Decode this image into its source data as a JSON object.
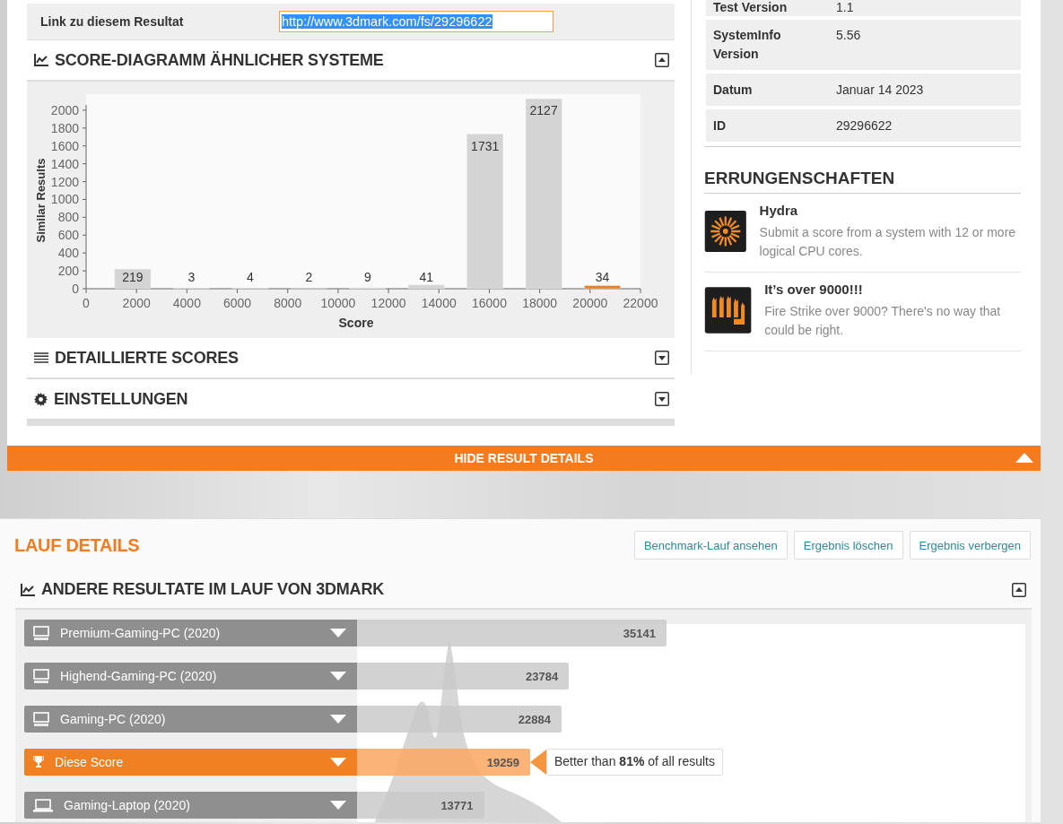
{
  "result_link": {
    "label": "Link zu diesem Resultat",
    "value": "http://www.3dmark.com/fs/29296622"
  },
  "sections": [
    {
      "kind": "chart",
      "title": "SCORE-DIAGRAMM ÄHNLICHER SYSTEME",
      "expanded": true,
      "highlight": {
        "color": "#f47b20",
        "bars": [
          false,
          false,
          false,
          false,
          false,
          false,
          false,
          false,
          true
        ]
      },
      "chart_data": {
        "type": "bar",
        "xlabel": "Score",
        "ylabel": "Similar Results",
        "x": [
          1850,
          4180,
          6510,
          8840,
          11170,
          13500,
          15830,
          18160,
          20490
        ],
        "series": [
          {
            "color": "#d4d4d4",
            "values": [
              219,
              3,
              4,
              2,
              9,
              41,
              1731,
              2127,
              34
            ]
          }
        ],
        "xlim": [
          0,
          22000
        ],
        "ylim": [
          0,
          2180
        ],
        "xticks": [
          0,
          2000,
          4000,
          6000,
          8000,
          10000,
          12000,
          14000,
          16000,
          18000,
          20000,
          22000
        ],
        "yticks": [
          0,
          200,
          400,
          600,
          800,
          1000,
          1200,
          1400,
          1600,
          1800,
          2000
        ],
        "data_labels": true
      }
    },
    {
      "kind": "list",
      "title": "DETAILLIERTE SCORES",
      "expanded": false
    },
    {
      "kind": "settings",
      "title": "EINSTELLUNGEN",
      "expanded": false
    }
  ],
  "info_rows": [
    {
      "label": "Test Version",
      "value": "1.1"
    },
    {
      "label": "SystemInfo Version",
      "value": "5.56"
    },
    {
      "label": "Datum",
      "value": "Januar 14 2023"
    },
    {
      "label": "ID",
      "value": "29296622"
    }
  ],
  "achievements": {
    "title": "ERRUNGENSCHAFTEN",
    "items": [
      {
        "kind": "cores",
        "title": "Hydra",
        "description": "Submit a score from a system with 12 or more logical CPU cores."
      },
      {
        "kind": "fire",
        "title": "It’s over 9000!!!",
        "description": "Fire Strike over 9000? There's no way that could be right."
      }
    ]
  },
  "hide_bar": {
    "label": "HIDE RESULT DETAILS"
  },
  "run_details": {
    "title": "LAUF DETAILS",
    "buttons": [
      "Benchmark-Lauf ansehen",
      "Ergebnis löschen",
      "Ergebnis verbergen"
    ],
    "section": {
      "title": "ANDERE RESULTATE IM LAUF VON 3DMARK",
      "expanded": true
    },
    "rows": [
      {
        "kind": "desktop",
        "name": "Premium-Gaming-PC (2020)",
        "score": "35141",
        "level": 0.463
      },
      {
        "kind": "desktop",
        "name": "Highend-Gaming-PC (2020)",
        "score": "23784",
        "level": 0.317
      },
      {
        "kind": "desktop",
        "name": "Gaming-PC (2020)",
        "score": "22884",
        "level": 0.306
      },
      {
        "kind": "yours",
        "name": "Diese Score",
        "score": "19259",
        "level": 0.259,
        "callout": "Better than **81%** of all results"
      },
      {
        "kind": "laptop",
        "name": "Gaming-Laptop (2020)",
        "score": "13771",
        "level": 0.19
      }
    ]
  }
}
